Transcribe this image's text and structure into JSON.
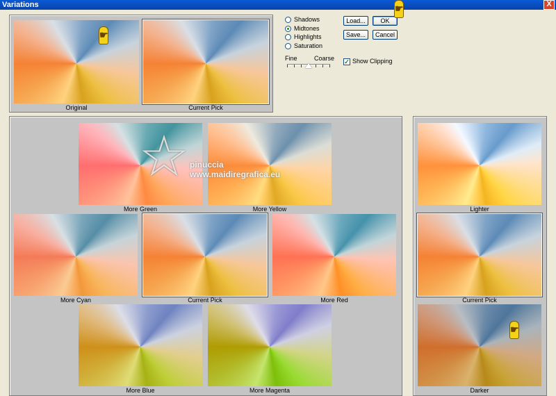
{
  "window": {
    "title": "Variations",
    "close_label": "X"
  },
  "preview": {
    "original_label": "Original",
    "current_pick_label": "Current Pick"
  },
  "tones": {
    "options": [
      "Shadows",
      "Midtones",
      "Highlights",
      "Saturation"
    ],
    "selected": "Midtones"
  },
  "slider": {
    "fine_label": "Fine",
    "coarse_label": "Coarse"
  },
  "buttons": {
    "load": "Load...",
    "ok": "OK",
    "save": "Save...",
    "cancel": "Cancel"
  },
  "show_clipping": {
    "label": "Show Clipping",
    "checked": true
  },
  "color_variations": {
    "more_green": "More Green",
    "more_yellow": "More Yellow",
    "more_cyan": "More Cyan",
    "current_pick": "Current Pick",
    "more_red": "More Red",
    "more_blue": "More Blue",
    "more_magenta": "More Magenta"
  },
  "brightness_variations": {
    "lighter": "Lighter",
    "current_pick": "Current Pick",
    "darker": "Darker"
  },
  "watermark": {
    "line1": "pinuccia",
    "line2": "www.maidiregrafica.eu"
  },
  "icons": [
    "pointing-hand-icon",
    "star-watermark-icon",
    "close-icon"
  ],
  "colors": {
    "titlebar": "#0a5ad6",
    "panel": "#c4c4c4",
    "dialog": "#ece9d8"
  }
}
